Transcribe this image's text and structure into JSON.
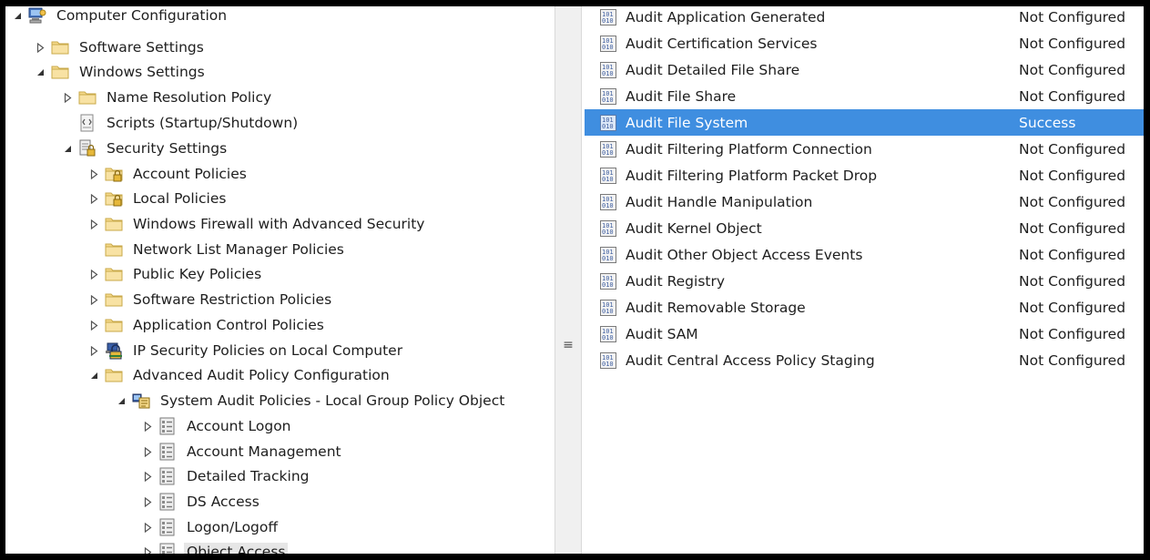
{
  "tree": {
    "items": [
      {
        "label": "Computer Configuration",
        "toggle": "expanded",
        "icon": "computer-icon",
        "level": 0
      },
      {
        "label": "Software Settings",
        "toggle": "collapsed",
        "icon": "folder-icon",
        "level": 1
      },
      {
        "label": "Windows Settings",
        "toggle": "expanded",
        "icon": "folder-icon",
        "level": 1
      },
      {
        "label": "Name Resolution Policy",
        "toggle": "collapsed",
        "icon": "folder-icon",
        "level": 2
      },
      {
        "label": "Scripts (Startup/Shutdown)",
        "toggle": "none",
        "icon": "script-icon",
        "level": 2
      },
      {
        "label": "Security Settings",
        "toggle": "expanded",
        "icon": "security-settings-icon",
        "level": 2
      },
      {
        "label": "Account Policies",
        "toggle": "collapsed",
        "icon": "locked-folder-icon",
        "level": 3
      },
      {
        "label": "Local Policies",
        "toggle": "collapsed",
        "icon": "locked-folder-icon",
        "level": 3
      },
      {
        "label": "Windows Firewall with Advanced Security",
        "toggle": "collapsed",
        "icon": "folder-icon",
        "level": 3
      },
      {
        "label": "Network List Manager Policies",
        "toggle": "none",
        "icon": "folder-icon",
        "level": 3
      },
      {
        "label": "Public Key Policies",
        "toggle": "collapsed",
        "icon": "folder-icon",
        "level": 3
      },
      {
        "label": "Software Restriction Policies",
        "toggle": "collapsed",
        "icon": "folder-icon",
        "level": 3
      },
      {
        "label": "Application Control Policies",
        "toggle": "collapsed",
        "icon": "folder-icon",
        "level": 3
      },
      {
        "label": "IP Security Policies on Local Computer",
        "toggle": "collapsed",
        "icon": "ip-security-icon",
        "level": 3
      },
      {
        "label": "Advanced Audit Policy Configuration",
        "toggle": "expanded",
        "icon": "folder-icon",
        "level": 3
      },
      {
        "label": "System Audit Policies - Local Group Policy Object",
        "toggle": "expanded",
        "icon": "audit-policy-icon",
        "level": 4
      },
      {
        "label": "Account Logon",
        "toggle": "collapsed",
        "icon": "policy-list-icon",
        "level": 5
      },
      {
        "label": "Account Management",
        "toggle": "collapsed",
        "icon": "policy-list-icon",
        "level": 5
      },
      {
        "label": "Detailed Tracking",
        "toggle": "collapsed",
        "icon": "policy-list-icon",
        "level": 5
      },
      {
        "label": "DS Access",
        "toggle": "collapsed",
        "icon": "policy-list-icon",
        "level": 5
      },
      {
        "label": "Logon/Logoff",
        "toggle": "collapsed",
        "icon": "policy-list-icon",
        "level": 5
      },
      {
        "label": "Object Access",
        "toggle": "collapsed",
        "icon": "policy-list-icon",
        "level": 5,
        "selected": true
      }
    ]
  },
  "scrollbar": {
    "grip": "≡"
  },
  "policies": {
    "rows": [
      {
        "name": "Audit Application Generated",
        "setting": "Not Configured"
      },
      {
        "name": "Audit Certification Services",
        "setting": "Not Configured"
      },
      {
        "name": "Audit Detailed File Share",
        "setting": "Not Configured"
      },
      {
        "name": "Audit File Share",
        "setting": "Not Configured"
      },
      {
        "name": "Audit File System",
        "setting": "Success",
        "selected": true
      },
      {
        "name": "Audit Filtering Platform Connection",
        "setting": "Not Configured"
      },
      {
        "name": "Audit Filtering Platform Packet Drop",
        "setting": "Not Configured"
      },
      {
        "name": "Audit Handle Manipulation",
        "setting": "Not Configured"
      },
      {
        "name": "Audit Kernel Object",
        "setting": "Not Configured"
      },
      {
        "name": "Audit Other Object Access Events",
        "setting": "Not Configured"
      },
      {
        "name": "Audit Registry",
        "setting": "Not Configured"
      },
      {
        "name": "Audit Removable Storage",
        "setting": "Not Configured"
      },
      {
        "name": "Audit SAM",
        "setting": "Not Configured"
      },
      {
        "name": "Audit Central Access Policy Staging",
        "setting": "Not Configured"
      }
    ]
  },
  "colors": {
    "selection": "#3f8ee0",
    "folder": "#f5d98a",
    "tree_selection": "#e6e6e6"
  }
}
